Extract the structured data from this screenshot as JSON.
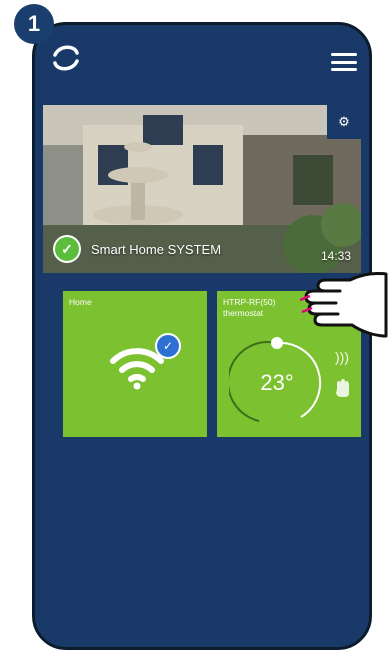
{
  "step": "1",
  "banner": {
    "title": "Smart Home SYSTEM",
    "time": "14:33"
  },
  "tiles": {
    "home": {
      "label": "Home"
    },
    "thermostat": {
      "label_line1": "HTRP-RF(50)",
      "label_line2": "thermostat",
      "temperature": "23°"
    }
  },
  "icons": {
    "logo": "salus-logo-icon",
    "menu": "hamburger-menu-icon",
    "settings": "gear-icon",
    "wifi": "wifi-icon",
    "heat": "heat-waves-icon",
    "manual": "hand-icon"
  },
  "colors": {
    "phone_bg": "#193a68",
    "tile_green": "#7cc12f",
    "check_green": "#5cbd3c",
    "wifi_check_blue": "#2d6fd2"
  }
}
